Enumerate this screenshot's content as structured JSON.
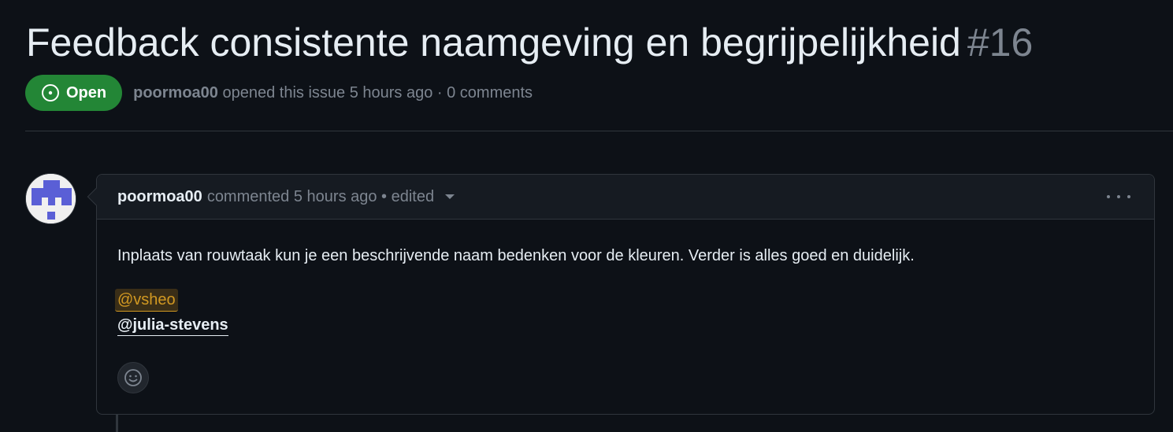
{
  "issue": {
    "title": "Feedback consistente naamgeving en begrijpelijkheid",
    "number": "#16",
    "state": "Open",
    "author": "poormoa00",
    "opened_text": "opened this issue 5 hours ago · 0 comments"
  },
  "comment": {
    "author": "poormoa00",
    "meta": "commented 5 hours ago • edited",
    "body": "Inplaats van rouwtaak kun je een beschrijvende naam bedenken voor de kleuren. Verder is alles goed en duidelijk.",
    "mention_self": "@vsheo",
    "mention_other": "@julia-stevens"
  },
  "colors": {
    "open_badge": "#238636",
    "self_mention": "#d29922",
    "avatar_pattern": "#5a5fd6"
  },
  "icons": {
    "state": "issue-open-icon",
    "menu": "kebab-horizontal-icon",
    "reaction": "smiley-icon",
    "edit_menu": "triangle-down-icon"
  }
}
